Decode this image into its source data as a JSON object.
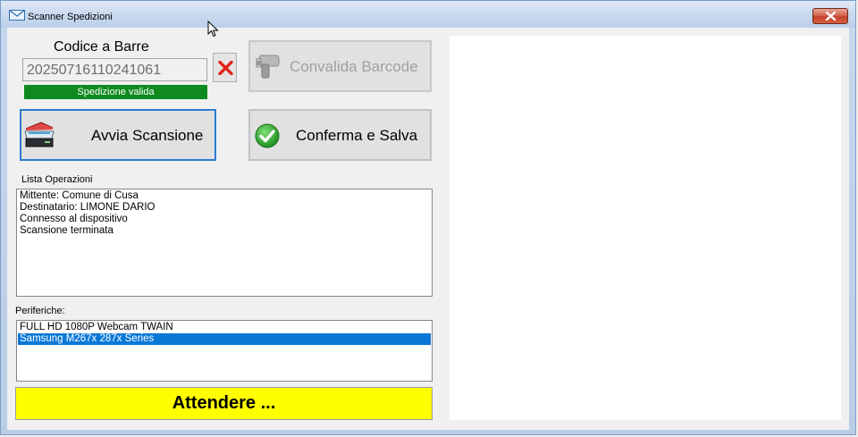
{
  "window": {
    "title": "Scanner Spedizioni"
  },
  "barcode": {
    "label": "Codice a Barre",
    "value": "20250716110241061",
    "status": "Spedizione valida",
    "status_color": "#0e8a1e"
  },
  "buttons": {
    "validate": "Convalida Barcode",
    "scan": "Avvia Scansione",
    "confirm": "Conferma e Salva"
  },
  "operations": {
    "label": "Lista Operazioni",
    "lines": [
      "Mittente: Comune di Cusa",
      "Destinatario: LIMONE DARIO",
      "Connesso al dispositivo",
      "Scansione terminata"
    ]
  },
  "devices": {
    "label": "Periferiche:",
    "items": [
      "FULL HD 1080P Webcam TWAIN",
      "Samsung M267x 287x Series"
    ],
    "selected_index": 1
  },
  "wait": {
    "text": "Attendere ...",
    "color": "#ffff00"
  },
  "icons": {
    "title": "mail-envelope-icon",
    "clear": "red-x-icon",
    "validate": "barcode-scanner-icon",
    "scan": "flatbed-scanner-icon",
    "confirm": "green-check-icon"
  }
}
